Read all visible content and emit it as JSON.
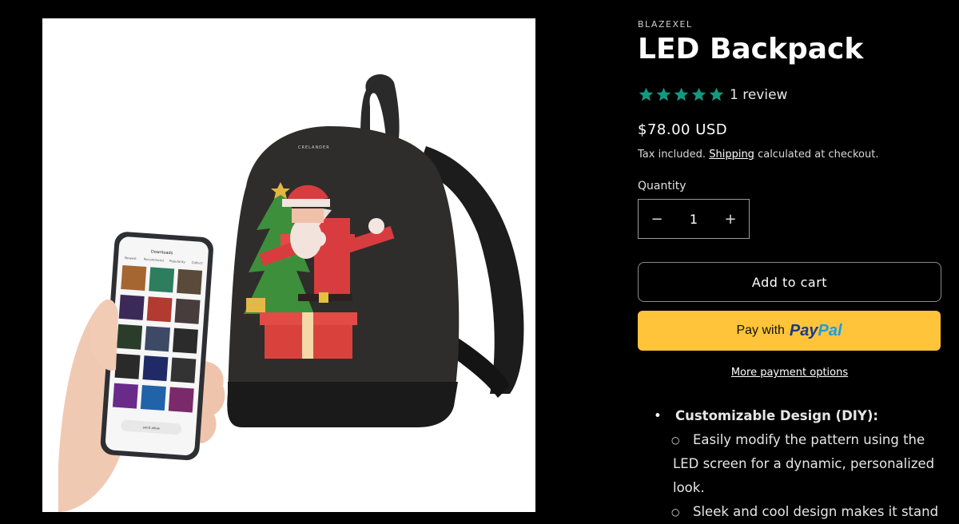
{
  "product": {
    "vendor": "BLAZEXEL",
    "title": "LED Backpack",
    "rating": 5,
    "review_count": "1 review",
    "price": "$78.00 USD",
    "tax_prefix": "Tax included.",
    "tax_link": "Shipping",
    "tax_suffix": "calculated at checkout.",
    "quantity_label": "Quantity",
    "quantity_value": "1",
    "minus": "−",
    "plus": "+",
    "add_to_cart": "Add to cart",
    "paypal_prefix": "Pay with",
    "paypal_brand_1": "Pay",
    "paypal_brand_2": "Pal",
    "more_payment": "More payment options",
    "star_color": "#14987f",
    "paypal_color": "#ffc43a"
  },
  "image": {
    "brand_on_bag": "CRELANDER",
    "phone_header": "Downloads",
    "phone_tabs": [
      "Newest",
      "Recommend",
      "Popularity",
      "Collect"
    ],
    "phone_button": "send allow"
  },
  "description": {
    "heading": "Customizable Design (DIY):",
    "sub_marker": "○",
    "item1_line1": "Easily modify the pattern using the",
    "item1_line2": "LED screen for a dynamic, personalized",
    "item1_line3": "look.",
    "item2_line1": "Sleek and cool design makes it stand"
  }
}
